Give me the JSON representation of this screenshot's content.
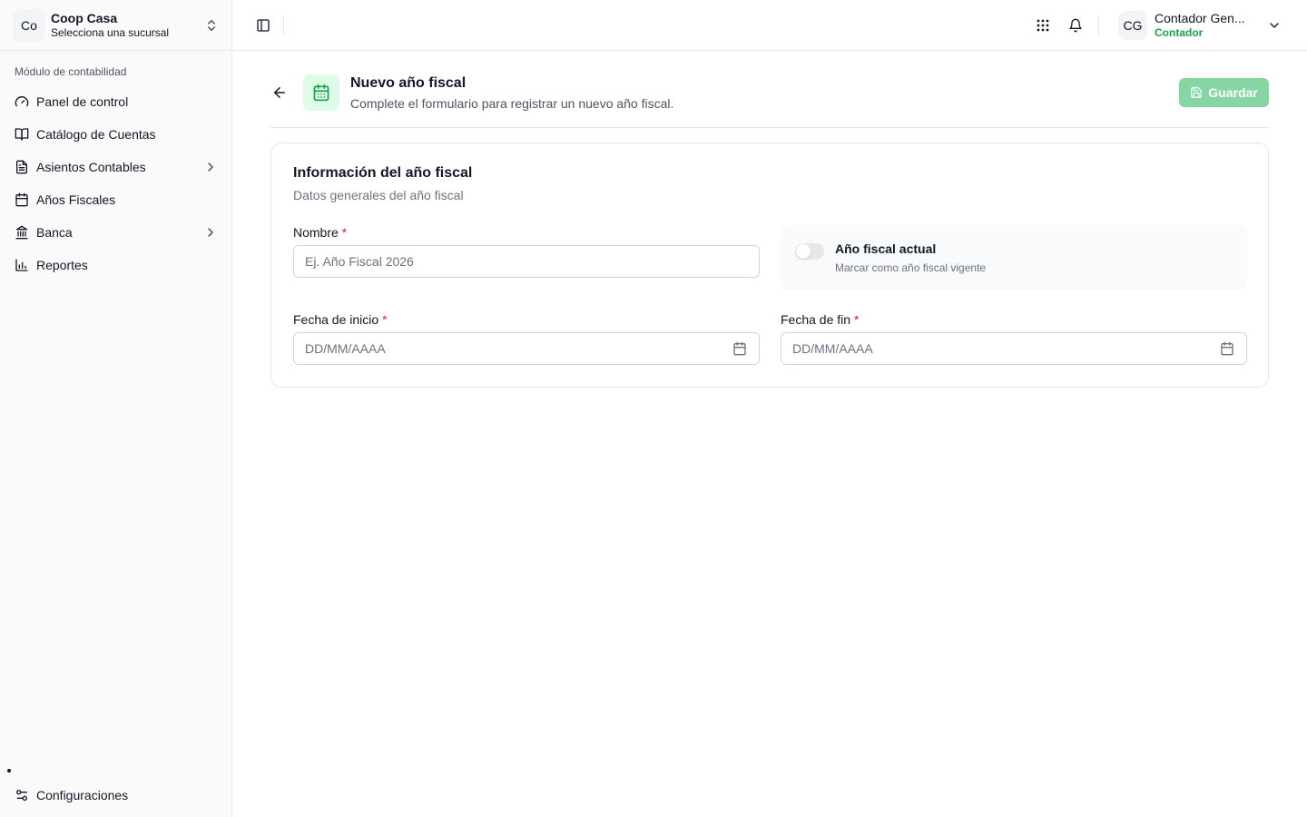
{
  "org": {
    "initials": "Co",
    "name": "Coop Casa",
    "subtitle": "Selecciona una sucursal"
  },
  "sidebar": {
    "section_label": "Módulo de contabilidad",
    "items": [
      {
        "label": "Panel de control",
        "icon": "gauge-icon"
      },
      {
        "label": "Catálogo de Cuentas",
        "icon": "book-open-icon"
      },
      {
        "label": "Asientos Contables",
        "icon": "file-text-icon",
        "expandable": true
      },
      {
        "label": "Años Fiscales",
        "icon": "calendar-icon"
      },
      {
        "label": "Banca",
        "icon": "bank-icon",
        "expandable": true
      },
      {
        "label": "Reportes",
        "icon": "bar-chart-icon"
      }
    ],
    "settings_label": "Configuraciones"
  },
  "topbar": {
    "user_initials": "CG",
    "user_name": "Contador Gen...",
    "user_role": "Contador",
    "accent_color": "#16a34a"
  },
  "page": {
    "title": "Nuevo año fiscal",
    "subtitle": "Complete el formulario para registrar un nuevo año fiscal.",
    "save_label": "Guardar"
  },
  "form": {
    "card_title": "Información del año fiscal",
    "card_subtitle": "Datos generales del año fiscal",
    "name_label": "Nombre",
    "name_placeholder": "Ej. Año Fiscal 2026",
    "required_mark": "*",
    "current_toggle_label": "Año fiscal actual",
    "current_toggle_desc": "Marcar como año fiscal vigente",
    "current_toggle_on": false,
    "start_label": "Fecha de inicio",
    "start_placeholder": "DD/MM/AAAA",
    "end_label": "Fecha de fin",
    "end_placeholder": "DD/MM/AAAA"
  }
}
